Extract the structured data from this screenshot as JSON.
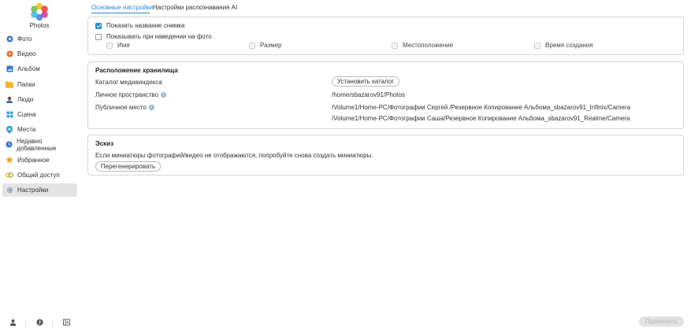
{
  "app": {
    "name": "Photos"
  },
  "sidebar": {
    "items": [
      {
        "label": "Фото",
        "icon": "photo-icon"
      },
      {
        "label": "Видео",
        "icon": "video-icon"
      },
      {
        "label": "Альбом",
        "icon": "album-icon"
      },
      {
        "label": "Папки",
        "icon": "folder-icon"
      },
      {
        "label": "Люди",
        "icon": "people-icon"
      },
      {
        "label": "Сцена",
        "icon": "scene-icon"
      },
      {
        "label": "Места",
        "icon": "places-icon"
      },
      {
        "label": "Недавно добавленные",
        "icon": "recent-icon"
      },
      {
        "label": "Избранное",
        "icon": "star-icon"
      },
      {
        "label": "Общий доступ",
        "icon": "share-icon"
      },
      {
        "label": "Настройки",
        "icon": "gear-icon",
        "active": true
      }
    ],
    "bottom_icons": [
      "user-icon",
      "help-icon",
      "collapse-sidebar-icon"
    ]
  },
  "tabs": [
    {
      "label": "Основные настройки",
      "active": true
    },
    {
      "label": "Настройки распознавания AI",
      "active": false
    }
  ],
  "general": {
    "show_title_label": "Показать название снимка",
    "show_title_checked": true,
    "show_on_hover_label": "Показывать при наведении на фото",
    "show_on_hover_checked": false,
    "hover_options": [
      "Имя",
      "Размер",
      "Местоположение",
      "Время создания"
    ]
  },
  "storage": {
    "title": "Расположение хранилища",
    "media_index_label": "Каталог медиаиндекса",
    "set_catalog_button": "Установить каталог",
    "personal_space_label": "Личное пространство",
    "personal_space_path": "/home/sbazarov91/Photos",
    "public_place_label": "Публичное место",
    "public_paths": [
      "/Volume1/Home-PC/Фотографии Сергей /Резервное Копирование Альбома_sbazarov91_Infinix/Camera",
      "/Volume1/Home-PC/Фотографии Саша/Резервное Копирование Альбома_sbazarov91_Realme/Camera"
    ],
    "info_glyph": "i"
  },
  "thumbnail": {
    "title": "Эскиз",
    "message": "Если миниатюры фотографий/видео не отображаются, попробуйте снова создать миниатюры.",
    "regenerate_button": "Перегенерировать"
  },
  "footer": {
    "apply_button": "Применить"
  },
  "colors": {
    "accent": "#2b8ad1",
    "active_bg": "#e4e4e4",
    "border": "#d6d6d6"
  }
}
